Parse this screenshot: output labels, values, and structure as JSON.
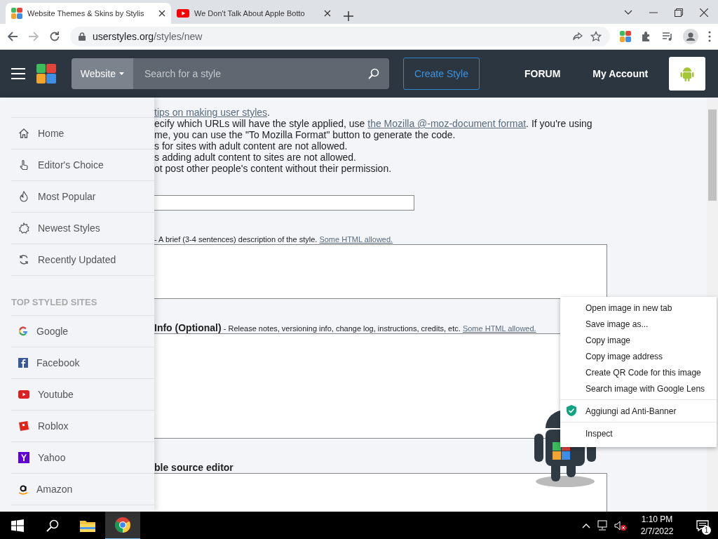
{
  "browser": {
    "tabs": [
      {
        "title": "Website Themes & Skins by Stylis",
        "selected": true
      },
      {
        "title": "We Don't Talk About Apple Botto",
        "selected": false
      }
    ],
    "url": {
      "host": "userstyles.org",
      "path": "/styles/new"
    }
  },
  "site_header": {
    "category": "Website",
    "search": {
      "placeholder": "Search for a style"
    },
    "create_button": "Create Style",
    "links": [
      "FORUM",
      "My Account"
    ]
  },
  "sidebar": {
    "nav": [
      {
        "label": "Home"
      },
      {
        "label": "Editor's Choice"
      },
      {
        "label": "Most Popular"
      },
      {
        "label": "Newest Styles"
      },
      {
        "label": "Recently Updated"
      }
    ],
    "section_title": "TOP STYLED SITES",
    "sites": [
      {
        "label": "Google"
      },
      {
        "label": "Facebook"
      },
      {
        "label": "Youtube"
      },
      {
        "label": "Roblox"
      },
      {
        "label": "Yahoo"
      },
      {
        "label": "Amazon"
      }
    ]
  },
  "content": {
    "intro": [
      [
        {
          "text": "tips on making user styles",
          "kind": "link"
        },
        {
          "text": ".",
          "kind": "plain"
        }
      ],
      [
        {
          "text": "ecify which URLs will have the style applied, use ",
          "kind": "plain"
        },
        {
          "text": "the Mozilla @-moz-document format",
          "kind": "link"
        },
        {
          "text": ". If you're using",
          "kind": "plain"
        }
      ],
      [
        {
          "text": "me, you can use the \"To Mozilla Format\" button to generate the code.",
          "kind": "plain"
        }
      ],
      [
        {
          "text": "s for sites with adult content are not allowed.",
          "kind": "plain"
        }
      ],
      [
        {
          "text": "s adding adult content to sites are not allowed.",
          "kind": "plain"
        }
      ],
      [
        {
          "text": "ot post other people's content without their permission.",
          "kind": "plain"
        }
      ]
    ],
    "fields": [
      {
        "kind": "input"
      },
      {
        "kind": "textarea",
        "label": [
          {
            "text": "- A brief (3-4 sentences) description of the style. ",
            "kind": "plain"
          },
          {
            "text": "Some HTML allowed.",
            "kind": "link"
          }
        ]
      },
      {
        "kind": "textarea",
        "label": [
          {
            "text": "Info (Optional)",
            "kind": "bold"
          },
          {
            "text": " - Release notes, versioning info, change log, instructions, credits, etc. ",
            "kind": "plain"
          },
          {
            "text": "Some HTML allowed.",
            "kind": "link"
          }
        ]
      },
      {
        "kind": "textarea",
        "label": [
          {
            "text": "ble source editor",
            "kind": "bold"
          }
        ]
      }
    ]
  },
  "context_menu": {
    "groups": [
      [
        {
          "label": "Open image in new tab"
        },
        {
          "label": "Save image as..."
        },
        {
          "label": "Copy image"
        },
        {
          "label": "Copy image address"
        },
        {
          "label": "Create QR Code for this image"
        },
        {
          "label": "Search image with Google Lens"
        }
      ],
      [
        {
          "label": "Aggiungi ad Anti-Banner"
        }
      ],
      [
        {
          "label": "Inspect"
        }
      ]
    ]
  },
  "taskbar": {
    "time": "1:10 PM",
    "date": "2/7/2022",
    "notifications": "1"
  }
}
